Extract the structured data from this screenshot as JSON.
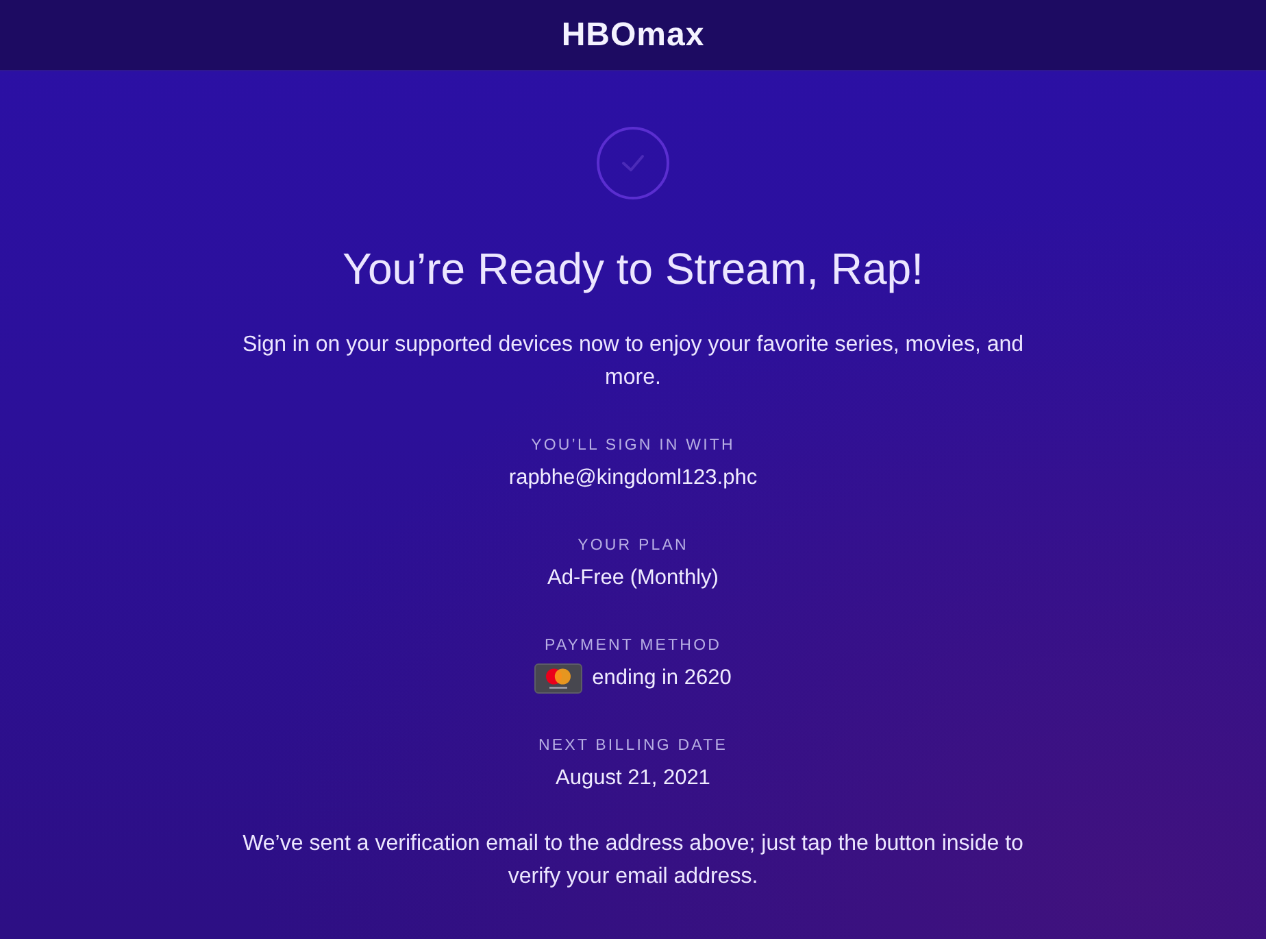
{
  "header": {
    "logo": "HBOmax"
  },
  "confirmation": {
    "title": "You’re Ready to Stream, Rap!",
    "message": "Sign in on your supported devices now to enjoy your favorite series, movies, and more."
  },
  "details": [
    {
      "kind": "text",
      "label": "YOU’LL SIGN IN WITH",
      "value": "rapbhe@kingdoml123.phc"
    },
    {
      "kind": "text",
      "label": "YOUR PLAN",
      "value": "Ad-Free (Monthly)"
    },
    {
      "kind": "card",
      "label": "PAYMENT METHOD",
      "value": "ending in 2620"
    },
    {
      "kind": "text",
      "label": "NEXT BILLING DATE",
      "value": "August 21, 2021"
    }
  ],
  "note": "We’ve sent a verification email to the address above; just tap the button inside to verify your email address."
}
